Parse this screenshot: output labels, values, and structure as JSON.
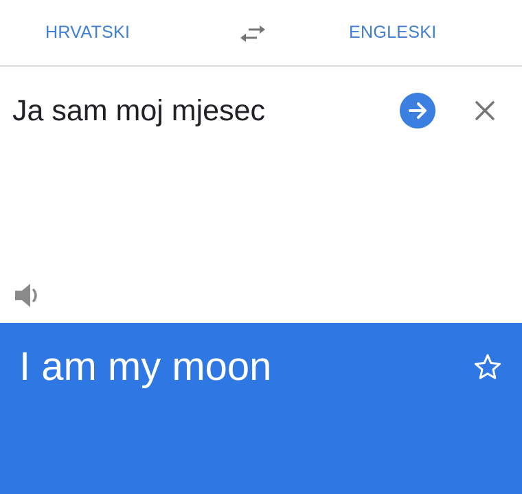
{
  "header": {
    "source_language": "HRVATSKI",
    "target_language": "ENGLESKI",
    "swap_icon": "swap-horiz-icon"
  },
  "input": {
    "text": "Ja sam moj mjesec",
    "go_icon": "arrow-forward-icon",
    "clear_icon": "close-icon",
    "listen_icon": "speaker-icon"
  },
  "output": {
    "text": "I am my moon",
    "save_icon": "star-outline-icon"
  },
  "colors": {
    "accent": "#3f7ed3",
    "output_bg": "#2f77e3",
    "go_button_bg": "#3b7fe0",
    "icon_gray": "#757575"
  }
}
